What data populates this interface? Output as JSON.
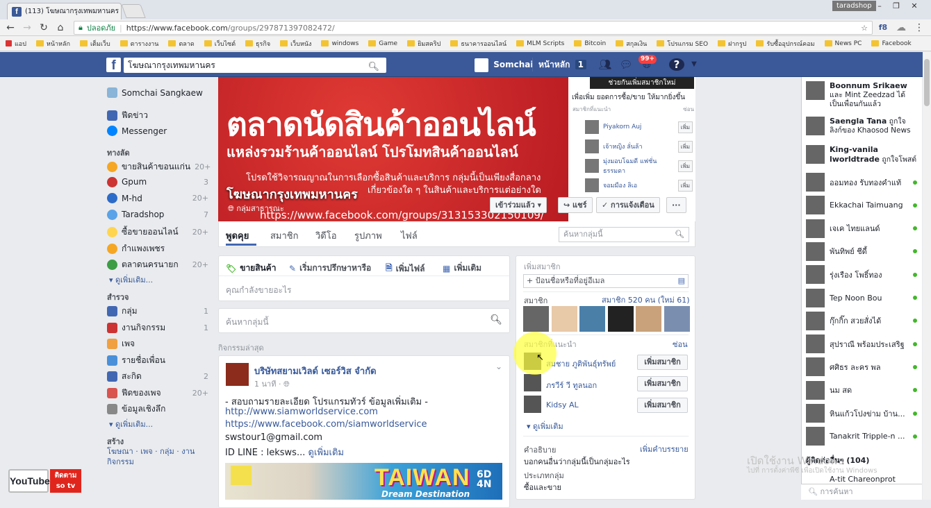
{
  "browser": {
    "tab_title": "(113) โฆษณากรุงเทพมหานคร",
    "profile": "taradshop",
    "secure_label": "ปลอดภัย",
    "url_host": "https://www.facebook.com",
    "url_path": "/groups/297871397082472/",
    "bookmarks": [
      "แอป",
      "หน้าหลัก",
      "เต็มเว็บ",
      "ตารางงาน",
      "ตลาด",
      "เว็บไซต์",
      "ธุรกิจ",
      "เว็บหนัง",
      "windows",
      "Game",
      "ยิมสคริป",
      "ธนาคารออนไลน์",
      "MLM Scripts",
      "Bitcoin",
      "สกุลเงิน",
      "โปรแกรม SEO",
      "ฝากรูป",
      "รับซื้ออุปกรณ์คอม",
      "News PC",
      "Facebook"
    ]
  },
  "fbbar": {
    "search_value": "โฆษณากรุงเทพมหานคร",
    "profile_name": "Somchai",
    "home_label": "หน้าหลัก",
    "home_count": "1",
    "notif_count": "99+"
  },
  "leftnav": {
    "user": "Somchai Sangkaew",
    "top": [
      {
        "label": "ฟีดข่าว"
      },
      {
        "label": "Messenger"
      }
    ],
    "shortcuts_header": "ทางลัด",
    "shortcuts": [
      {
        "label": "ขายสินค้าขอนแก่น",
        "count": "20+"
      },
      {
        "label": "Gpum",
        "count": "3"
      },
      {
        "label": "M-hd",
        "count": "20+"
      },
      {
        "label": "Taradshop",
        "count": "7"
      },
      {
        "label": "ซื้อขายออนไลน์",
        "count": "20+"
      },
      {
        "label": "กำแพงเพชร",
        "count": ""
      },
      {
        "label": "ตลาดนครนายก",
        "count": "20+"
      }
    ],
    "more1": "ดูเพิ่มเติม...",
    "explore_header": "สำรวจ",
    "explore": [
      {
        "label": "กลุ่ม",
        "count": "1"
      },
      {
        "label": "งานกิจกรรม",
        "count": "1"
      },
      {
        "label": "เพจ",
        "count": ""
      },
      {
        "label": "รายชื่อเพื่อน",
        "count": ""
      },
      {
        "label": "สะกิด",
        "count": "2"
      },
      {
        "label": "ฟีดของเพจ",
        "count": "20+"
      },
      {
        "label": "ข้อมูลเชิงลึก",
        "count": ""
      }
    ],
    "more2": "ดูเพิ่มเติม...",
    "create_header": "สร้าง",
    "create_links": "โฆษณา · เพจ · กลุ่ม · งานกิจกรรม"
  },
  "cover": {
    "headline": "ตลาดนัดสินค้าออนไลน์",
    "subline": "แหล่งรวมร้านค้าออนไลน์ โปรโมทสินค้าออนไลน์",
    "desc1": "โปรดใช้วิจารณญาณในการเลือกซื้อสินค้าและบริการ กลุ่มนี้เป็นเพียงสื่อกลาง",
    "desc2": "เกี่ยวข้องใด ๆ ในสินค้าและบริการแต่อย่างใด",
    "url": "https://www.facebook.com/groups/313153302150109/",
    "group_name": "โฆษณากรุงเทพมหานคร",
    "group_type": "กลุ่มสาธารณะ",
    "tooltip": "ช่วยกันเพิ่มสมาชิกใหม่",
    "right_title": "เพื่อเพิ่ม ยอดการซื้อ/ขาย ให้มากยิ่งขึ้น",
    "right_sub_left": "สมาชิกที่แนะนำ",
    "right_sub_right": "ซ่อน",
    "suggest_rows": [
      {
        "name": "Piyakorn Auj",
        "btn": "เพิ่ม"
      },
      {
        "name": "เจ้าหญิง ลั่นล้า",
        "btn": "เพิ่ม"
      },
      {
        "name": "มุ่งมอบโฉมดี แฟชั่น ธรรมดา",
        "btn": "เพิ่ม"
      },
      {
        "name": "จอมมือง ลิเอ",
        "btn": "เพิ่ม"
      }
    ],
    "joined_btn": "เข้าร่วมแล้ว",
    "share_btn": "แชร์",
    "notif_btn": "การแจ้งเตือน",
    "more_btn": "···"
  },
  "tabs": [
    "พูดคุย",
    "สมาชิก",
    "วิดีโอ",
    "รูปภาพ",
    "ไฟล์"
  ],
  "group_search_placeholder": "ค้นหากลุ่มนี้",
  "composer": {
    "tabs": [
      "ขายสินค้า",
      "เริ่มการปรึกษาหารือ",
      "เพิ่มไฟล์",
      "เพิ่มเติม"
    ],
    "prompt": "คุณกำลังขายอะไร"
  },
  "search2_placeholder": "ค้นหากลุ่มนี้",
  "recent_label": "กิจกรรมล่าสุด",
  "post": {
    "author": "บริษัทสยามเวิลด์ เซอร์วิส จำกัด",
    "time": "1 นาที",
    "line1": "- สอบถามรายละเอียด โปรแกรมทัวร์ ข้อมูลเพิ่มเติม -",
    "link1": "http://www.siamworldservice.com",
    "link2": "https://www.facebook.com/siamworldservice",
    "email": "swstour1@gmail.com",
    "line_id": "ID LINE : leksws...",
    "see_more": "ดูเพิ่มเติม",
    "img_title": "TAIWAN",
    "img_days1": "6D",
    "img_days2": "4N",
    "img_sub": "Dream Destination"
  },
  "right": {
    "add_members": "เพิ่มสมาชิก",
    "add_placeholder": "+ ป้อนชื่อหรือที่อยู่อีเมล",
    "members_label": "สมาชิก",
    "members_count": "สมาชิก 520 คน (ใหม่ 61)",
    "suggested_label": "สมาชิกที่แนะนำ",
    "hide": "ซ่อน",
    "suggestions": [
      {
        "name": "สมชาย ภูติพันธุ์ทรัพย์",
        "btn": "เพิ่มสมาชิก"
      },
      {
        "name": "ภรวีร์ วี ทูลนอก",
        "btn": "เพิ่มสมาชิก"
      },
      {
        "name": "Kidsy AL",
        "btn": "เพิ่มสมาชิก"
      }
    ],
    "see_more": "ดูเพิ่มเติม",
    "desc_label": "คำอธิบาย",
    "desc_add": "เพิ่มคำบรรยาย",
    "desc_text": "บอกคนอื่นว่ากลุ่มนี้เป็นกลุ่มอะไร",
    "type_label": "ประเภทกลุ่ม",
    "type_value": "ซื้อและขาย"
  },
  "chat": {
    "stories": [
      {
        "name": "Boonnum Srikaew",
        "text": "และ Mint Zeedzad ได้เป็นเพื่อนกันแล้ว"
      },
      {
        "name": "Saengla Tana",
        "text": "ถูกใจ ลิงก์ของ Khaosod News"
      },
      {
        "name": "King-vanila lworldtrade",
        "text": "ถูกใจโพสต์"
      }
    ],
    "contacts": [
      {
        "name": "ออมทอง รับทองคำแท้"
      },
      {
        "name": "Ekkachai Taimuang"
      },
      {
        "name": "เจเค ไทยแลนด์"
      },
      {
        "name": "พันทิพย์ ชีดี้"
      },
      {
        "name": "รุ่งเรือง โพธิ์ทอง"
      },
      {
        "name": "Tep Noon Bou"
      },
      {
        "name": "กุ๊กกิ๊ก สวยสั่งได้"
      },
      {
        "name": "สุปราณี พร้อมประเสริฐ"
      },
      {
        "name": "ศศิธร ละคร พล"
      },
      {
        "name": "นม สด"
      },
      {
        "name": "หินแก้วโปงข่าม บ้าน..."
      },
      {
        "name": "Tanakrit Tripple-n ..."
      }
    ],
    "other_contacts": "ผู้ติดต่ออื่นๆ (104)",
    "last_contact": "A-tit Chareonprot",
    "search_placeholder": "การค้นหา"
  },
  "overlay": {
    "yt_text": "YouTube",
    "yt_follow": "ติดตาม",
    "yt_channel": "so tv",
    "watermark1": "เปิดใช้งาน Windows",
    "watermark2": "ไปที่ การตั้งค่าพีซี เพื่อเปิดใช้งาน Windows"
  },
  "colors": {
    "fb_blue": "#3b5998",
    "link": "#365899",
    "online": "#42b72a",
    "cover_red": "#d3202a"
  }
}
